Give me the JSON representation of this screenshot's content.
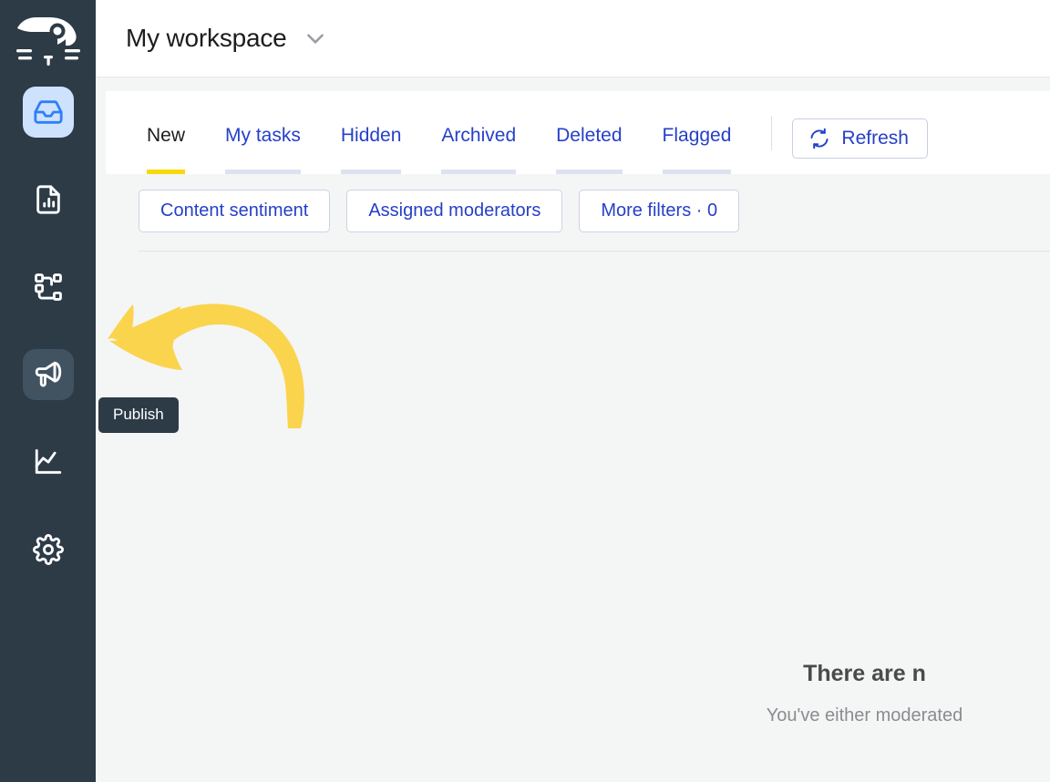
{
  "sidebar": {
    "logo_name": "cat-whale-logo",
    "bg_color": "#2d3b47",
    "items": [
      {
        "name": "inbox",
        "icon": "inbox-icon",
        "state": "active",
        "tooltip": ""
      },
      {
        "name": "reports",
        "icon": "document-chart-icon",
        "state": "",
        "tooltip": ""
      },
      {
        "name": "workflow",
        "icon": "workflow-nodes-icon",
        "state": "",
        "tooltip": ""
      },
      {
        "name": "publish",
        "icon": "megaphone-icon",
        "state": "hover",
        "tooltip": "Publish"
      },
      {
        "name": "analytics",
        "icon": "line-chart-icon",
        "state": "",
        "tooltip": ""
      },
      {
        "name": "settings",
        "icon": "gear-icon",
        "state": "",
        "tooltip": ""
      }
    ]
  },
  "tooltip": {
    "label": "Publish"
  },
  "header": {
    "workspace_title": "My workspace",
    "chevron_icon": "chevron-down-icon"
  },
  "tabs": {
    "items": [
      {
        "label": "New",
        "active": true
      },
      {
        "label": "My tasks",
        "active": false
      },
      {
        "label": "Hidden",
        "active": false
      },
      {
        "label": "Archived",
        "active": false
      },
      {
        "label": "Deleted",
        "active": false
      },
      {
        "label": "Flagged",
        "active": false
      }
    ],
    "active_underline_color": "#f7d908",
    "inactive_underline_color": "#dde2f0",
    "refresh_label": "Refresh",
    "refresh_icon": "refresh-icon"
  },
  "filters": {
    "chips": [
      {
        "label": "Content sentiment"
      },
      {
        "label": "Assigned moderators"
      },
      {
        "label": "More filters · 0"
      }
    ]
  },
  "annotation": {
    "arrow_color": "#fad44c",
    "arrow_direction": "curved-left"
  },
  "empty_state": {
    "title": "There are n",
    "subtitle": "You've either moderated"
  },
  "colors": {
    "sidebar": "#2d3b47",
    "accent_blue": "#2640c8",
    "icon_blue": "#2d7ff9",
    "active_tab_yellow": "#f7d908",
    "page_bg": "#f4f5f5"
  }
}
